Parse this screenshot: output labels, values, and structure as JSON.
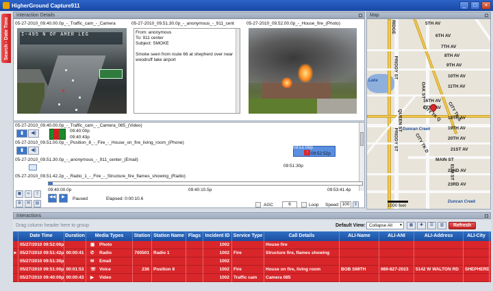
{
  "app": {
    "title": "HigherGround Capture911"
  },
  "window_buttons": [
    "_",
    "□",
    "×"
  ],
  "side_tab": {
    "label": "Search - Date Time"
  },
  "panels": {
    "details": "Interaction Details",
    "map": "Map",
    "interactions": "Interactions"
  },
  "media": [
    {
      "caption": "05-27-2010_09.40.00.0p_-_Traffic_cam_-_Camera",
      "osd": "I-495 N  OF  AMER LEG"
    },
    {
      "caption": "05-27-2010_09.51.30.0p_-_anonymous_-_911_cent",
      "from": "From: anonymous",
      "to": "To: 911 center",
      "subject": "Subject: SMOKE",
      "body": "Smoke seen from route 66 at shepherd over near woodruff lake airport"
    },
    {
      "caption": "05-27-2010_09.52.00.0p_-_House_fire_(Photo)"
    }
  ],
  "tracks": [
    {
      "label": "05-27-2010_09.40.00.0p_-_Traffic_cam_-_Camera_085_(Video)",
      "t1": "09:40:00p",
      "t2": "09:40:43p"
    },
    {
      "label": "05-27-2010_09.51.00.0p_-_Position_8_-_Fire_-_House_on_fire_living_room_(Phone)",
      "t1": "09:51:00p",
      "t2": "09:52:52p"
    },
    {
      "label": "05-27-2010_09.51.30.0p_-_anonymous_-_911_center_(Email)",
      "t1": "09:51:30p"
    },
    {
      "label": "05-27-2010_09.51.42.2p_-_Radio_1_-_Fire_-_Structure_fire_flames_showing_(Radio)"
    }
  ],
  "playback": {
    "start": "09:40:00.0p",
    "mid": "09:40:10.5p",
    "end": "09:53:41.4p",
    "status": "Paused",
    "elapsed": "Elapsed: 0:00:10.6",
    "agc_label": "AGC",
    "agc_value": "6",
    "loop_label": "Loop",
    "speed_label": "Speed:",
    "speed_value": "100"
  },
  "map": {
    "streets": [
      "5TH AV",
      "6TH AV",
      "7TH AV",
      "8TH AV",
      "9TH AV",
      "10TH AV",
      "11TH AV",
      "12TH AV",
      "13TH AV",
      "14TH AV",
      "16TH AV",
      "17TH AV",
      "18TH AV",
      "19TH AV",
      "20TH AV",
      "21ST AV",
      "22ND AV",
      "23RD AV",
      "OAK ST",
      "PRIDDY ST",
      "QUEEN ST",
      "CITY TK Q",
      "CITY TK S",
      "CITY TK D",
      "MAIN ST",
      "ELM ST",
      "RIDGE",
      "BIRCH ST",
      "MAIN CT"
    ],
    "water": [
      "Lake",
      "Duncan Creek",
      "Duncan Creek"
    ],
    "scale": "1000 feet"
  },
  "grid": {
    "drag_text": "Drag column header here to group",
    "default_view_label": "Default View:",
    "default_view_value": "Collapse All",
    "refresh_label": "Refresh",
    "columns": [
      "Date Time",
      "Duration",
      "Media Types",
      "Station",
      "Station Name",
      "Flags",
      "Incident ID",
      "Service Type",
      "Call Details",
      "ALI-Name",
      "ALI-ANI",
      "ALI-Address",
      "ALI-City"
    ],
    "rows": [
      {
        "marker": "",
        "date": "05/27/2010 09:52:00p",
        "duration": "",
        "media": "Photo",
        "station": "",
        "station_name": "",
        "flags": "",
        "incident": "1002",
        "service": "",
        "details": "House fire",
        "ali_name": "",
        "ali_ani": "",
        "ali_address": "",
        "ali_city": ""
      },
      {
        "marker": "►",
        "date": "05/27/2010 09:51:42p",
        "duration": "00:00:41",
        "media": "Radio",
        "station": "700501",
        "station_name": "Radio 1",
        "flags": "",
        "incident": "1002",
        "service": "Fire",
        "details": "Structure fire, flames showing",
        "ali_name": "",
        "ali_ani": "",
        "ali_address": "",
        "ali_city": ""
      },
      {
        "marker": "",
        "date": "05/27/2010 09:51:30p",
        "duration": "",
        "media": "Email",
        "station": "",
        "station_name": "",
        "flags": "",
        "incident": "1002",
        "service": "",
        "details": "",
        "ali_name": "",
        "ali_ani": "",
        "ali_address": "",
        "ali_city": ""
      },
      {
        "marker": "",
        "date": "05/27/2010 09:51:00p",
        "duration": "00:01:53",
        "media": "Voice",
        "station": "236",
        "station_name": "Position 8",
        "flags": "",
        "incident": "1002",
        "service": "Fire",
        "details": "House on fire, living room",
        "ali_name": "BOB SMITH",
        "ali_ani": "989-827-2023",
        "ali_address": "5142 W WALTON RD",
        "ali_city": "SHEPHERD"
      },
      {
        "marker": "",
        "date": "05/27/2010 09:40:00p",
        "duration": "00:00:43",
        "media": "Video",
        "station": "",
        "station_name": "",
        "flags": "",
        "incident": "1002",
        "service": "Traffic cam",
        "details": "Camera 085",
        "ali_name": "",
        "ali_ani": "",
        "ali_address": "",
        "ali_city": ""
      }
    ]
  },
  "colors": {
    "accent": "#1c4fa0",
    "row_red": "#d9262a",
    "title_blue": "#2d64c8"
  }
}
